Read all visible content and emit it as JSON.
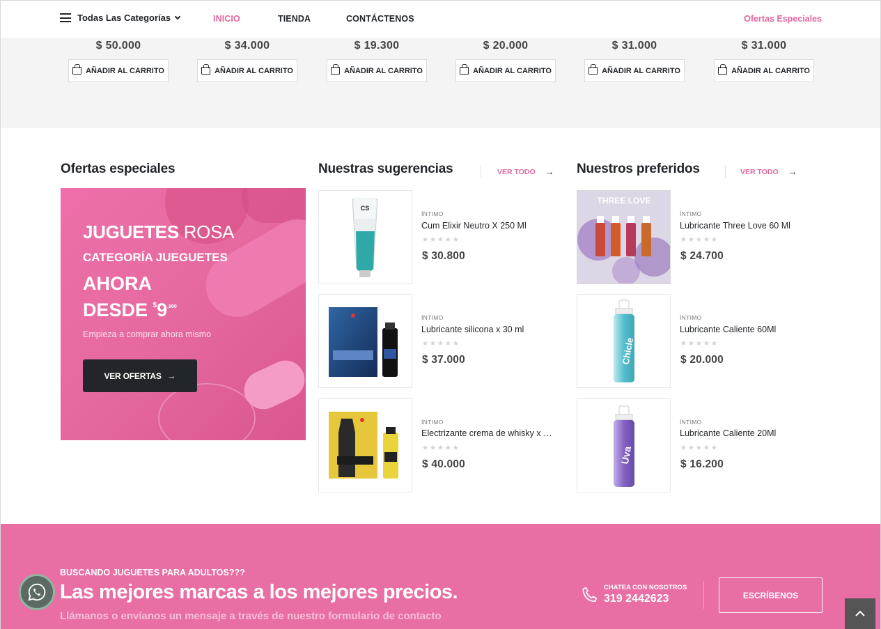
{
  "nav": {
    "categories_label": "Todas Las Categorías",
    "links": [
      "INICIO",
      "TIENDA",
      "CONTÁCTENOS"
    ],
    "special_offers": "Ofertas Especiales"
  },
  "strip": {
    "products": [
      {
        "price": "$ 50.000",
        "cart": "AÑADIR AL CARRITO"
      },
      {
        "price": "$ 34.000",
        "cart": "AÑADIR AL CARRITO"
      },
      {
        "price": "$ 19.300",
        "cart": "AÑADIR AL CARRITO"
      },
      {
        "price": "$ 20.000",
        "cart": "AÑADIR AL CARRITO"
      },
      {
        "price": "$ 31.000",
        "cart": "AÑADIR AL CARRITO"
      },
      {
        "price": "$ 31.000",
        "cart": "AÑADIR AL CARRITO"
      }
    ]
  },
  "offers": {
    "title": "Ofertas especiales",
    "banner": {
      "line1_bold": "JUGUETES",
      "line1_light": "ROSA",
      "line2": "CATEGORÍA JUEGUETES",
      "line3": "AHORA",
      "line4": "DESDE",
      "price_sup": "$",
      "price_main": "9",
      "price_cents": ".900",
      "subtitle": "Empieza a comprar ahora mismo",
      "button": "VER OFERTAS"
    }
  },
  "suggestions": {
    "title": "Nuestras sugerencias",
    "see_all": "VER TODO",
    "items": [
      {
        "category": "ÍNTIMO",
        "name": "Cum Elixir Neutro X 250 Ml",
        "price": "$ 30.800"
      },
      {
        "category": "ÍNTIMO",
        "name": "Lubricante silicona x 30 ml",
        "price": "$ 37.000"
      },
      {
        "category": "ÍNTIMO",
        "name": "Electrizante crema de whisky x …",
        "price": "$ 40.000"
      }
    ]
  },
  "favorites": {
    "title": "Nuestros preferidos",
    "see_all": "VER TODO",
    "items": [
      {
        "category": "ÍNTIMO",
        "name": "Lubricante Three Love 60 Ml",
        "price": "$ 24.700"
      },
      {
        "category": "ÍNTIMO",
        "name": "Lubricante Caliente 60Ml",
        "price": "$ 20.000"
      },
      {
        "category": "ÍNTIMO",
        "name": "Lubricante Caliente 20Ml",
        "price": "$ 16.200"
      }
    ]
  },
  "product_images": {
    "three_love_label": "THREE LOVE",
    "chicle_label": "Chicle",
    "uva_label": "Uva",
    "cs_label": "CS"
  },
  "cta": {
    "kicker": "BUSCANDO JUGUETES PARA ADULTOS???",
    "headline": "Las mejores marcas a los mejores precios.",
    "sub": "Llámanos o envíanos un mensaje a través de nuestro formulario de contacto",
    "chat_label": "CHATEA CON NOSOTROS",
    "phone": "319 2442623",
    "button": "ESCRÍBENOS"
  },
  "colors": {
    "accent": "#e2669e",
    "dark": "#222529",
    "cta_bg": "#e86ea4"
  }
}
